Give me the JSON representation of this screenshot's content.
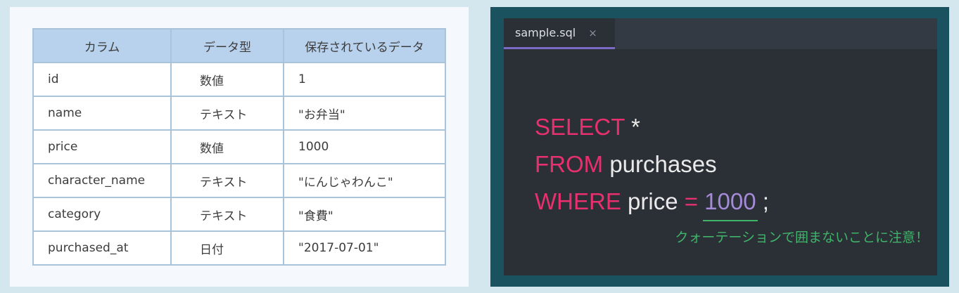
{
  "table": {
    "headers": [
      "カラム",
      "データ型",
      "保存されているデータ"
    ],
    "rows": [
      [
        "id",
        "数値",
        "1"
      ],
      [
        "name",
        "テキスト",
        "\"お弁当\""
      ],
      [
        "price",
        "数値",
        "1000"
      ],
      [
        "character_name",
        "テキスト",
        "\"にんじゃわんこ\""
      ],
      [
        "category",
        "テキスト",
        "\"食費\""
      ],
      [
        "purchased_at",
        "日付",
        "\"2017-07-01\""
      ]
    ]
  },
  "editor": {
    "tab_label": "sample.sql",
    "close_glyph": "×",
    "code": {
      "line1": {
        "kw": "SELECT",
        "rest": "*"
      },
      "line2": {
        "kw": "FROM",
        "rest": "purchases"
      },
      "line3": {
        "kw": "WHERE",
        "col": "price",
        "op": "=",
        "num": "1000",
        "end": ";"
      }
    },
    "note": "クォーテーションで囲まないことに注意！"
  },
  "colors": {
    "keyword": "#e8306e",
    "number": "#a48ad7",
    "note": "#40b46a",
    "tab_accent": "#7b6bc7",
    "table_header": "#b8d1ec"
  }
}
